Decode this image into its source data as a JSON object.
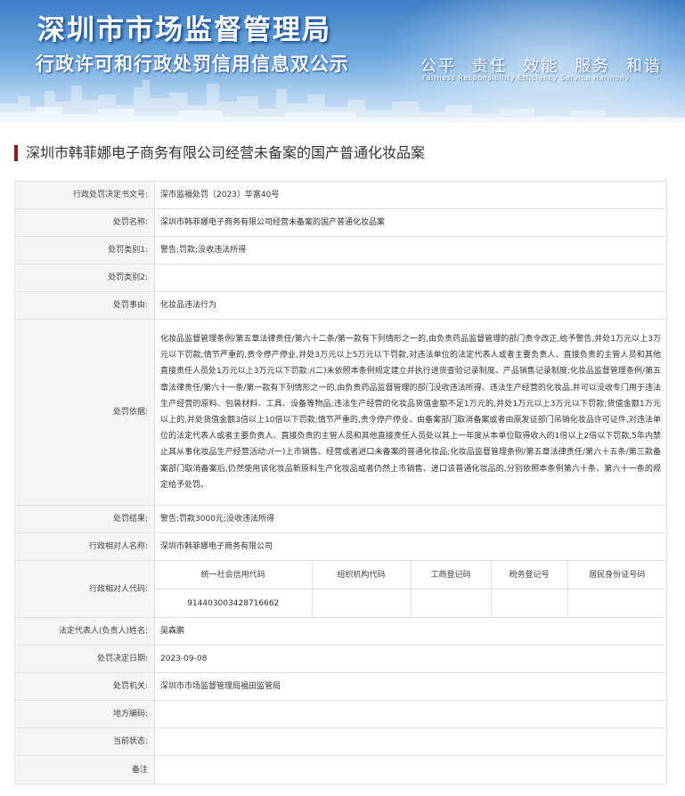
{
  "banner": {
    "title": "深圳市市场监督管理局",
    "subtitle": "行政许可和行政处罚信用信息双公示",
    "values_cn": "公平 责任 效能 服务 和谐",
    "values_en": "Fairness Responsibility Efficiency Service Harmony"
  },
  "page_title": "深圳市韩菲娜电子商务有限公司经营未备案的国产普通化妆品案",
  "rows": {
    "decision_no": {
      "label": "行政处罚决定书文号:",
      "value": "深市监福处罚〔2023〕华富40号"
    },
    "penalty_name": {
      "label": "处罚名称:",
      "value": "深圳市韩菲娜电子商务有限公司经营未备案的国产普通化妆品案"
    },
    "category1": {
      "label": "处罚类别1:",
      "value": "警告;罚款;没收违法所得"
    },
    "category2": {
      "label": "处罚类别2:",
      "value": ""
    },
    "reason": {
      "label": "处罚事由:",
      "value": "化妆品违法行为"
    },
    "basis": {
      "label": "处罚依据:",
      "value": "化妆品监督管理条例/第五章法律责任/第六十二条/第一款有下列情形之一的,由负责药品监督管理的部门责令改正,给予警告,并处1万元以上3万元以下罚款;情节严重的,责令停产停业,并处3万元以上5万元以下罚款,对违法单位的法定代表人或者主要负责人、直接负责的主管人员和其他直接责任人员处1万元以上3万元以下罚款:/(二)未依照本条例规定建立并执行进货查验记录制度、产品销售记录制度;化妆品监督管理条例/第五章法律责任/第六十一条/第一款有下列情形之一的,由负责药品监督管理的部门没收违法所得、违法生产经营的化妆品,并可以没收专门用于违法生产经营的原料、包装材料、工具、设备等物品;违法生产经营的化妆品货值金额不足1万元的,并处1万元以上3万元以下罚款;货值金额1万元以上的,并处货值金额3倍以上10倍以下罚款;情节严重的,责令停产停业、由备案部门取消备案或者由原发证部门吊销化妆品许可证件,对违法单位的法定代表人或者主要负责人、直接负责的主管人员和其他直接责任人员处以其上一年度从本单位取得收入的1倍以上2倍以下罚款,5年内禁止其从事化妆品生产经营活动:/(一)上市销售、经营或者进口未备案的普通化妆品;化妆品监督管理条例/第五章法律责任/第六十五条/第三款备案部门取消备案后,仍然使用该化妆品新原料生产化妆品或者仍然上市销售、进口该普通化妆品的,分别依照本条例第六十条、第六十一条的规定给予处罚。"
    },
    "result": {
      "label": "处罚结果:",
      "value": "警告;罚款3000元;没收违法所得"
    },
    "party_name": {
      "label": "行政相对人名称:",
      "value": "深圳市韩菲娜电子商务有限公司"
    },
    "party_code": {
      "label": "行政相对人代码:",
      "headers": [
        "统一社会信用代码",
        "组织机构代码",
        "工商登记码",
        "税务登记号",
        "居民身份证号码"
      ],
      "values": [
        "914403003428716662",
        "",
        "",
        "",
        ""
      ]
    },
    "legal_rep": {
      "label": "法定代表人(负责人)姓名:",
      "value": "吴森鹏"
    },
    "decision_date": {
      "label": "处罚决定日期:",
      "value": "2023-09-08"
    },
    "authority": {
      "label": "处罚机关:",
      "value": "深圳市市场监督管理局福田监管局"
    },
    "region_code": {
      "label": "地方编码:",
      "value": ""
    },
    "status": {
      "label": "当前状态:",
      "value": ""
    },
    "remarks": {
      "label": "备注",
      "value": ""
    }
  }
}
